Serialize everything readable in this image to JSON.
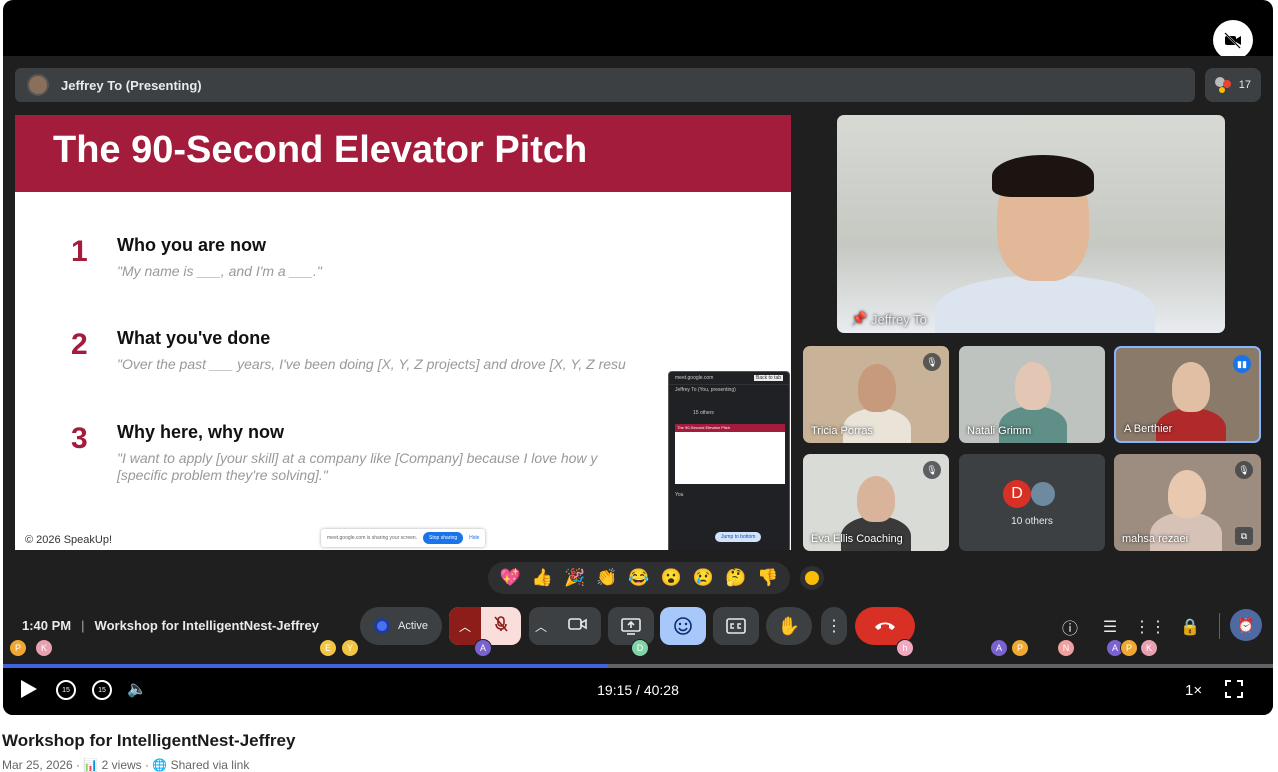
{
  "presenter": {
    "label": "Jeffrey To (Presenting)",
    "participant_count": "17"
  },
  "slide": {
    "title": "The 90-Second Elevator Pitch",
    "points": [
      {
        "num": "1",
        "title": "Who you are now",
        "sub": "\"My name is ___, and I'm a ___.\""
      },
      {
        "num": "2",
        "title": "What you've done",
        "sub": "\"Over the past ___ years, I've been doing [X, Y, Z projects] and drove [X, Y, Z resu"
      },
      {
        "num": "3",
        "title": "Why here, why now",
        "sub": "\"I want to apply [your skill] at a company like [Company] because I love how y",
        "sub2": "[specific problem they're solving].\""
      }
    ],
    "copyright": "© 2026 SpeakUp!",
    "share_notice": "meet.google.com is sharing your screen.",
    "stop_sharing": "Stop sharing",
    "hide": "Hide"
  },
  "mini_window": {
    "url": "meet.google.com",
    "back_to_tab": "Back to tab",
    "jeffrey": "Jeffrey To (You, presenting)",
    "others": "15 others",
    "jump": "Jump to bottom",
    "chat_from": "You"
  },
  "tiles": {
    "jeffrey": "Jeffrey To",
    "tile_1": "Tricia Porras",
    "tile_2": "Natali Grimm",
    "tile_3": "A Berthier",
    "tile_4": "Eva Ellis Coaching",
    "others_count": "10 others",
    "others_initial": "D",
    "tile_6": "mahsa rezaei"
  },
  "reactions": [
    "💖",
    "👍",
    "🎉",
    "👏",
    "😂",
    "😮",
    "😢",
    "🤔",
    "👎"
  ],
  "meeting": {
    "time": "1:40 PM",
    "name": "Workshop for IntelligentNest-Jeffrey",
    "active_label": "Active"
  },
  "bubbles": [
    {
      "letter": "P",
      "color": "#f0a830"
    },
    {
      "letter": "K",
      "color": "#e8a0b0"
    },
    {
      "letter": "E",
      "color": "#f4c542"
    },
    {
      "letter": "Y",
      "color": "#f4c542"
    },
    {
      "letter": "A",
      "color": "#7a63d0"
    },
    {
      "letter": "D",
      "color": "#7fd4a8"
    },
    {
      "letter": "h",
      "color": "#f2a8c0"
    },
    {
      "letter": "A",
      "color": "#7a63d0"
    },
    {
      "letter": "P",
      "color": "#f0a830"
    },
    {
      "letter": "N",
      "color": "#f0a0a0"
    },
    {
      "letter": "A",
      "color": "#7a63d0"
    },
    {
      "letter": "P",
      "color": "#f0a830"
    },
    {
      "letter": "K",
      "color": "#e8a0b0"
    }
  ],
  "player": {
    "current_time": "19:15",
    "duration": "40:28",
    "time_display": "19:15 / 40:28",
    "progress": 0.476,
    "speed": "1×",
    "skip_seconds": "15"
  },
  "video": {
    "title": "Workshop for IntelligentNest-Jeffrey",
    "meta": "Mar 25, 2026  ·  📊 2 views  ·  🌐 Shared via link"
  },
  "colors": {
    "accent": "#a31c3c",
    "progress": "#3d63dd",
    "end_call": "#d93025"
  }
}
